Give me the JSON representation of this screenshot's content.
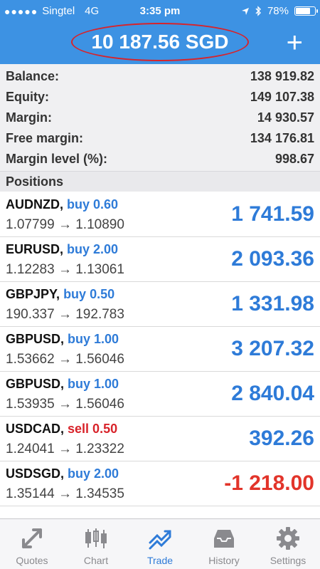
{
  "status_bar": {
    "signal": "●●●●●",
    "carrier": "Singtel",
    "network": "4G",
    "time": "3:35 pm",
    "battery": "78%"
  },
  "header": {
    "title": "10 187.56 SGD",
    "add_label": "+"
  },
  "summary": {
    "rows": [
      {
        "label": "Balance:",
        "value": "138 919.82"
      },
      {
        "label": "Equity:",
        "value": "149 107.38"
      },
      {
        "label": "Margin:",
        "value": "14 930.57"
      },
      {
        "label": "Free margin:",
        "value": "134 176.81"
      },
      {
        "label": "Margin level (%):",
        "value": "998.67"
      }
    ]
  },
  "positions_header": "Positions",
  "positions": [
    {
      "symbol": "AUDNZD,",
      "direction": "buy 0.60",
      "prices": "1.07799 → 1.10890",
      "profit": "1 741.59"
    },
    {
      "symbol": "EURUSD,",
      "direction": "buy 2.00",
      "prices": "1.12283 → 1.13061",
      "profit": "2 093.36"
    },
    {
      "symbol": "GBPJPY,",
      "direction": "buy 0.50",
      "prices": "190.337 → 192.783",
      "profit": "1 331.98"
    },
    {
      "symbol": "GBPUSD,",
      "direction": "buy 1.00",
      "prices": "1.53662 → 1.56046",
      "profit": "3 207.32"
    },
    {
      "symbol": "GBPUSD,",
      "direction": "buy 1.00",
      "prices": "1.53935 → 1.56046",
      "profit": "2 840.04"
    },
    {
      "symbol": "USDCAD,",
      "direction": "sell 0.50",
      "prices": "1.24041 → 1.23322",
      "profit": "392.26"
    },
    {
      "symbol": "USDSGD,",
      "direction": "buy 2.00",
      "prices": "1.35144 → 1.34535",
      "profit": "-1 218.00"
    }
  ],
  "tabs": [
    {
      "label": "Quotes",
      "icon": "quotes-icon"
    },
    {
      "label": "Chart",
      "icon": "chart-icon"
    },
    {
      "label": "Trade",
      "icon": "trade-icon"
    },
    {
      "label": "History",
      "icon": "history-icon"
    },
    {
      "label": "Settings",
      "icon": "settings-icon"
    }
  ],
  "colors": {
    "header_bg": "#3d92e3",
    "profit_positive": "#2e7bd8",
    "profit_negative": "#e2342a",
    "sell": "#d8232a",
    "annotation_circle": "#d8232a"
  }
}
